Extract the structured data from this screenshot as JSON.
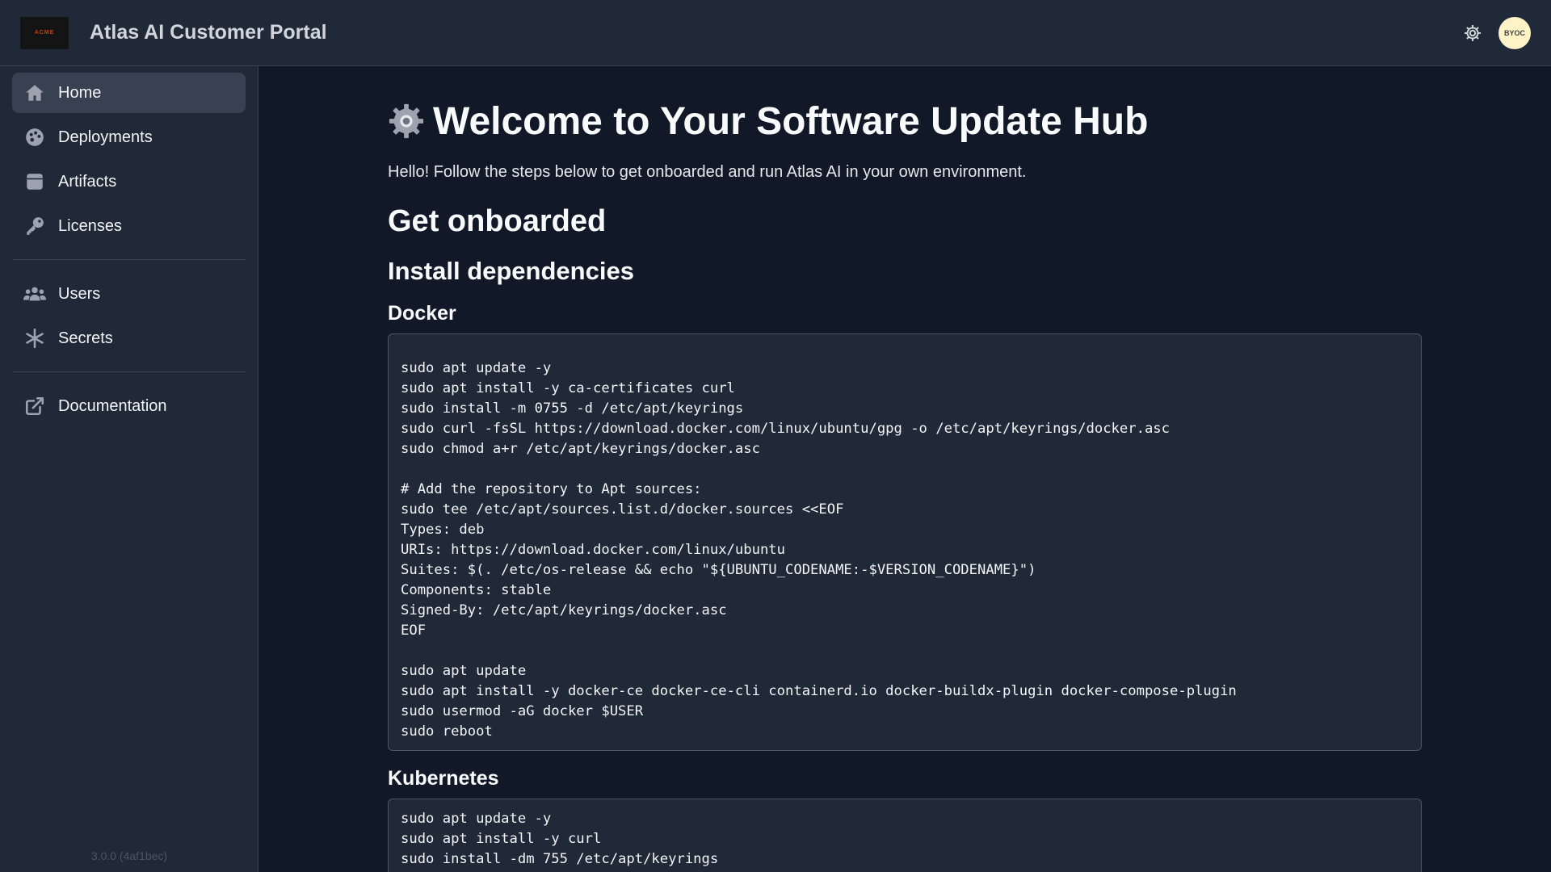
{
  "header": {
    "logo_text": "ACME",
    "title": "Atlas AI Customer Portal",
    "settings_icon": "gear-icon",
    "avatar_text": "BYOC"
  },
  "sidebar": {
    "items": [
      {
        "label": "Home",
        "icon": "home-icon",
        "active": true
      },
      {
        "label": "Deployments",
        "icon": "palette-icon"
      },
      {
        "label": "Artifacts",
        "icon": "box-icon"
      },
      {
        "label": "Licenses",
        "icon": "key-icon"
      },
      {
        "label": "Users",
        "icon": "users-icon"
      },
      {
        "label": "Secrets",
        "icon": "asterisk-icon"
      },
      {
        "label": "Documentation",
        "icon": "external-link-icon"
      }
    ],
    "version": "3.0.0 (4af1bec)"
  },
  "main": {
    "title": "Welcome to Your Software Update Hub",
    "intro": "Hello! Follow the steps below to get onboarded and run Atlas AI in your own environment.",
    "section_title": "Get onboarded",
    "subsection_title": "Install dependencies",
    "docker": {
      "title": "Docker",
      "code": "sudo apt update -y\nsudo apt install -y ca-certificates curl\nsudo install -m 0755 -d /etc/apt/keyrings\nsudo curl -fsSL https://download.docker.com/linux/ubuntu/gpg -o /etc/apt/keyrings/docker.asc\nsudo chmod a+r /etc/apt/keyrings/docker.asc\n\n# Add the repository to Apt sources:\nsudo tee /etc/apt/sources.list.d/docker.sources <<EOF\nTypes: deb\nURIs: https://download.docker.com/linux/ubuntu\nSuites: $(. /etc/os-release && echo \"${UBUNTU_CODENAME:-$VERSION_CODENAME}\")\nComponents: stable\nSigned-By: /etc/apt/keyrings/docker.asc\nEOF\n\nsudo apt update\nsudo apt install -y docker-ce docker-ce-cli containerd.io docker-buildx-plugin docker-compose-plugin\nsudo usermod -aG docker $USER\nsudo reboot"
    },
    "kubernetes": {
      "title": "Kubernetes",
      "code": "sudo apt update -y\nsudo apt install -y curl\nsudo install -dm 755 /etc/apt/keyrings"
    }
  }
}
